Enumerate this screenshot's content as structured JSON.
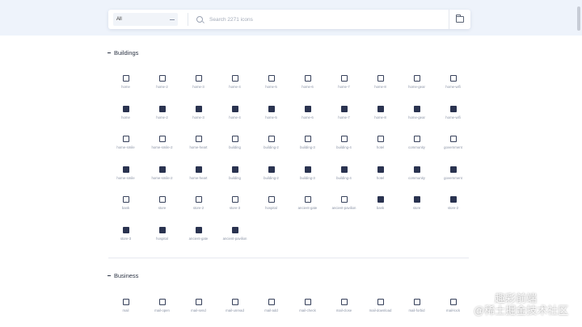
{
  "toolbar": {
    "category_value": "All",
    "search_placeholder": "Search 2271 icons",
    "folder_icon": "folder-icon"
  },
  "sections": [
    {
      "title": "Buildings",
      "icons": [
        {
          "label": "home",
          "style": "outline"
        },
        {
          "label": "home-2",
          "style": "outline"
        },
        {
          "label": "home-3",
          "style": "outline"
        },
        {
          "label": "home-4",
          "style": "outline"
        },
        {
          "label": "home-5",
          "style": "outline"
        },
        {
          "label": "home-6",
          "style": "outline"
        },
        {
          "label": "home-7",
          "style": "outline"
        },
        {
          "label": "home-8",
          "style": "outline"
        },
        {
          "label": "home-gear",
          "style": "outline"
        },
        {
          "label": "home-wifi",
          "style": "outline"
        },
        {
          "label": "home",
          "style": "solid"
        },
        {
          "label": "home-2",
          "style": "solid"
        },
        {
          "label": "home-3",
          "style": "solid"
        },
        {
          "label": "home-4",
          "style": "solid"
        },
        {
          "label": "home-5",
          "style": "solid"
        },
        {
          "label": "home-6",
          "style": "solid"
        },
        {
          "label": "home-7",
          "style": "solid"
        },
        {
          "label": "home-8",
          "style": "solid"
        },
        {
          "label": "home-gear",
          "style": "solid"
        },
        {
          "label": "home-wifi",
          "style": "solid"
        },
        {
          "label": "home-smile",
          "style": "outline"
        },
        {
          "label": "home-smile-2",
          "style": "outline"
        },
        {
          "label": "home-heart",
          "style": "outline"
        },
        {
          "label": "building",
          "style": "outline"
        },
        {
          "label": "building-2",
          "style": "outline"
        },
        {
          "label": "building-3",
          "style": "outline"
        },
        {
          "label": "building-4",
          "style": "outline"
        },
        {
          "label": "hotel",
          "style": "outline"
        },
        {
          "label": "community",
          "style": "outline"
        },
        {
          "label": "government",
          "style": "outline"
        },
        {
          "label": "home-smile",
          "style": "solid"
        },
        {
          "label": "home-smile-2",
          "style": "solid"
        },
        {
          "label": "home-heart",
          "style": "solid"
        },
        {
          "label": "building",
          "style": "solid"
        },
        {
          "label": "building-2",
          "style": "solid"
        },
        {
          "label": "building-3",
          "style": "solid"
        },
        {
          "label": "building-4",
          "style": "solid"
        },
        {
          "label": "hotel",
          "style": "solid"
        },
        {
          "label": "community",
          "style": "solid"
        },
        {
          "label": "government",
          "style": "solid"
        },
        {
          "label": "bank",
          "style": "outline"
        },
        {
          "label": "store",
          "style": "outline"
        },
        {
          "label": "store-2",
          "style": "outline"
        },
        {
          "label": "store-3",
          "style": "outline"
        },
        {
          "label": "hospital",
          "style": "outline"
        },
        {
          "label": "ancient-gate",
          "style": "outline"
        },
        {
          "label": "ancient-pavilion",
          "style": "outline"
        },
        {
          "label": "bank",
          "style": "solid"
        },
        {
          "label": "store",
          "style": "solid"
        },
        {
          "label": "store-2",
          "style": "solid"
        },
        {
          "label": "store-3",
          "style": "solid"
        },
        {
          "label": "hospital",
          "style": "solid"
        },
        {
          "label": "ancient-gate",
          "style": "solid"
        },
        {
          "label": "ancient-pavilion",
          "style": "solid"
        }
      ]
    },
    {
      "title": "Business",
      "icons": [
        {
          "label": "mail",
          "style": "outline"
        },
        {
          "label": "mail-open",
          "style": "outline"
        },
        {
          "label": "mail-send",
          "style": "outline"
        },
        {
          "label": "mail-unread",
          "style": "outline"
        },
        {
          "label": "mail-add",
          "style": "outline"
        },
        {
          "label": "mail-check",
          "style": "outline"
        },
        {
          "label": "mail-close",
          "style": "outline"
        },
        {
          "label": "mail-download",
          "style": "outline"
        },
        {
          "label": "mail-forbid",
          "style": "outline"
        },
        {
          "label": "mail-lock",
          "style": "outline"
        }
      ]
    }
  ],
  "watermark": {
    "line1": "趣彩前端",
    "line2": "@稀土掘金技术社区"
  }
}
